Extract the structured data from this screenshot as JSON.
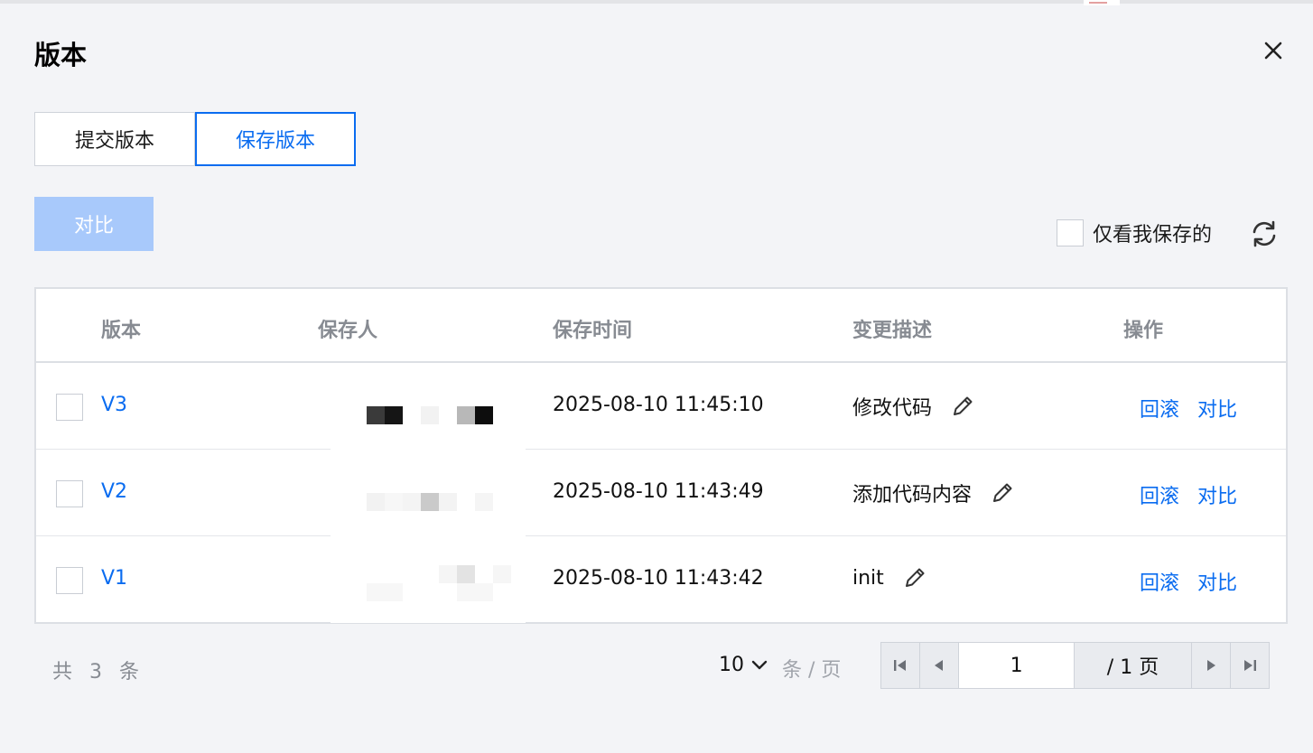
{
  "dialog": {
    "title": "版本",
    "close_icon": "close-icon"
  },
  "tabs": [
    {
      "label": "提交版本",
      "active": false
    },
    {
      "label": "保存版本",
      "active": true
    }
  ],
  "toolbar": {
    "compare_label": "对比",
    "only_mine_label": "仅看我保存的",
    "refresh_icon": "refresh-icon"
  },
  "table": {
    "columns": [
      "版本",
      "保存人",
      "保存时间",
      "变更描述",
      "操作"
    ],
    "rows": [
      {
        "version": "V3",
        "saver": "",
        "time": "2025-08-10 11:45:10",
        "description": "修改代码",
        "actions": [
          "回滚",
          "对比"
        ]
      },
      {
        "version": "V2",
        "saver": "",
        "time": "2025-08-10 11:43:49",
        "description": "添加代码内容",
        "actions": [
          "回滚",
          "对比"
        ]
      },
      {
        "version": "V1",
        "saver": "",
        "time": "2025-08-10 11:43:42",
        "description": "init",
        "actions": [
          "回滚",
          "对比"
        ]
      }
    ]
  },
  "pagination": {
    "total_text": "共 3 条",
    "page_size": "10",
    "per_page_label": "条 / 页",
    "current_page": "1",
    "total_pages_text": "/ 1 页"
  },
  "colors": {
    "accent": "#0a6cf0",
    "disabled_button": "#a8c9fb",
    "background": "#f3f4f7"
  }
}
